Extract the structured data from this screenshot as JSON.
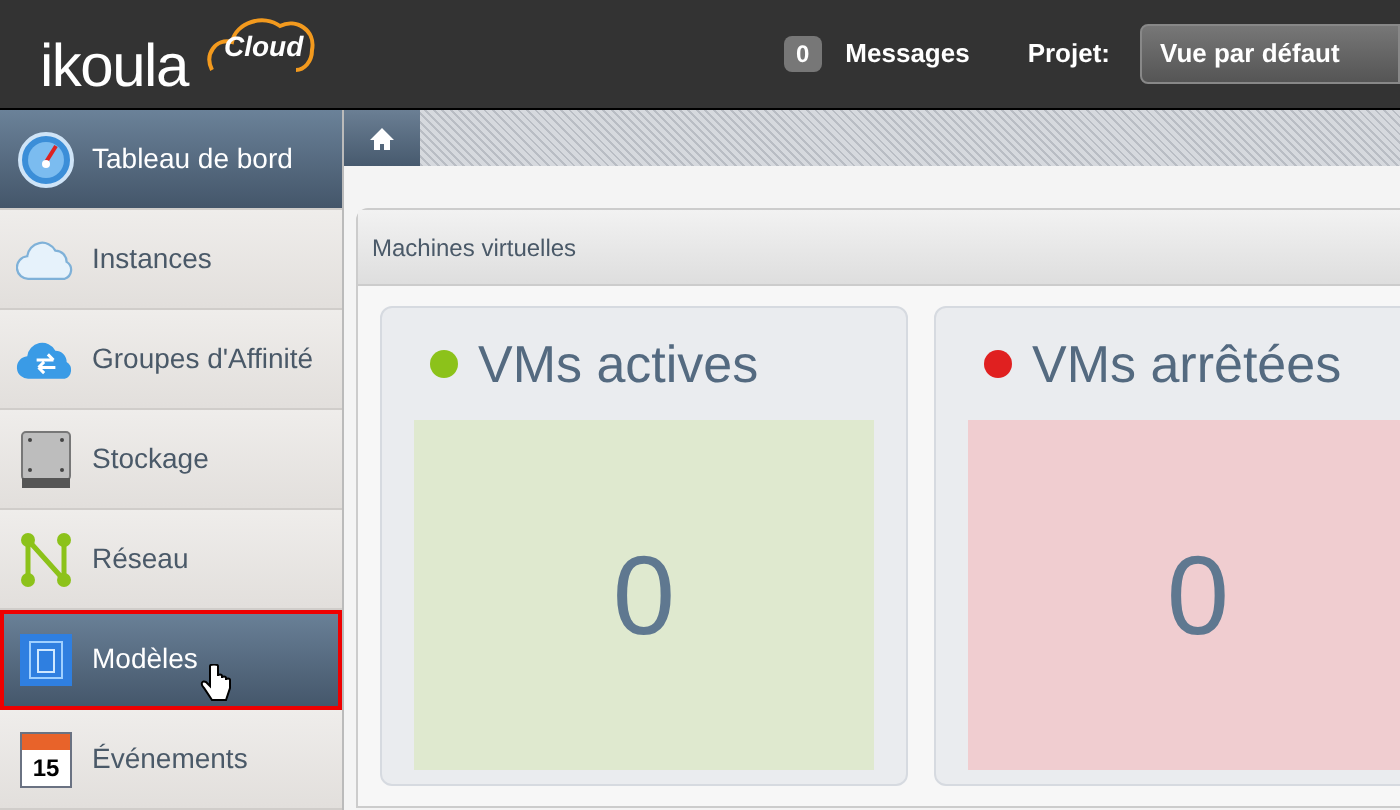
{
  "header": {
    "logo": {
      "name": "ikoula",
      "badge": "Cloud"
    },
    "messages": {
      "count": "0",
      "label": "Messages"
    },
    "project": {
      "label": "Projet:",
      "value": "Vue par défaut"
    }
  },
  "sidebar": {
    "items": [
      {
        "label": "Tableau de bord",
        "kind": "gauge",
        "selected": true,
        "highlighted": false
      },
      {
        "label": "Instances",
        "kind": "cloud",
        "selected": false,
        "highlighted": false
      },
      {
        "label": "Groupes d'Affinité",
        "kind": "cloudarrows",
        "selected": false,
        "highlighted": false
      },
      {
        "label": "Stockage",
        "kind": "drive",
        "selected": false,
        "highlighted": false
      },
      {
        "label": "Réseau",
        "kind": "network",
        "selected": false,
        "highlighted": false
      },
      {
        "label": "Modèles",
        "kind": "template",
        "selected": true,
        "highlighted": true
      },
      {
        "label": "Événements",
        "kind": "calendar",
        "selected": false,
        "highlighted": false,
        "icon_text": "15"
      }
    ]
  },
  "panel": {
    "title": "Machines virtuelles",
    "cards": [
      {
        "title": "VMs actives",
        "color": "#8cc21a",
        "count": "0",
        "kind": "active"
      },
      {
        "title": "VMs arrêtées",
        "color": "#e02020",
        "count": "0",
        "kind": "stopped"
      }
    ]
  }
}
